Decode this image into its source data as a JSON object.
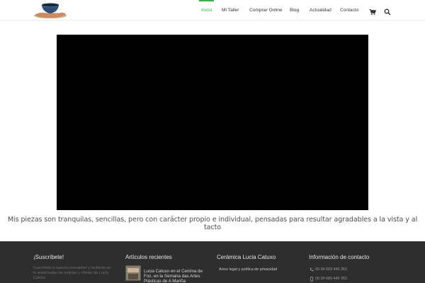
{
  "header": {
    "logo_alt": "Cerámica Lucia Catuxo",
    "nav": [
      "Inicio",
      "Mi Taller",
      "Comprar Online",
      "Blog",
      "Actualidad",
      "Contacto"
    ],
    "active_index": 0,
    "icons": [
      "cart-icon",
      "search-icon"
    ]
  },
  "main": {
    "tagline": "Mis piezas son tranquilas, sencillas, pero con carácter propio e individual, pensadas para resultar agradables a la vista y al tacto"
  },
  "footer": {
    "subscribe": {
      "title": "¡Suscríbete!",
      "text": "Suscríbete a nuestra newsletter y recibirás en tu email todas las noticias y ofertas de Lucía Catuxo."
    },
    "recent": {
      "title": "Artículos recientes",
      "post_title": "Lucia Catuxo en el Cenima de Foz, en la Semana das Artes Plásticas de A Mariña"
    },
    "company": {
      "title": "Cerámica Lucia Catuxo",
      "link": "Aviso legal y política de privacidad"
    },
    "contact": {
      "title": "Información de contacto",
      "phone": "00 34 669 446 352",
      "mobile": "00 34 669 446 352"
    }
  },
  "colors": {
    "accent": "#3fae49",
    "footer_bg": "#2e2e2e",
    "video_bg": "#000000"
  }
}
